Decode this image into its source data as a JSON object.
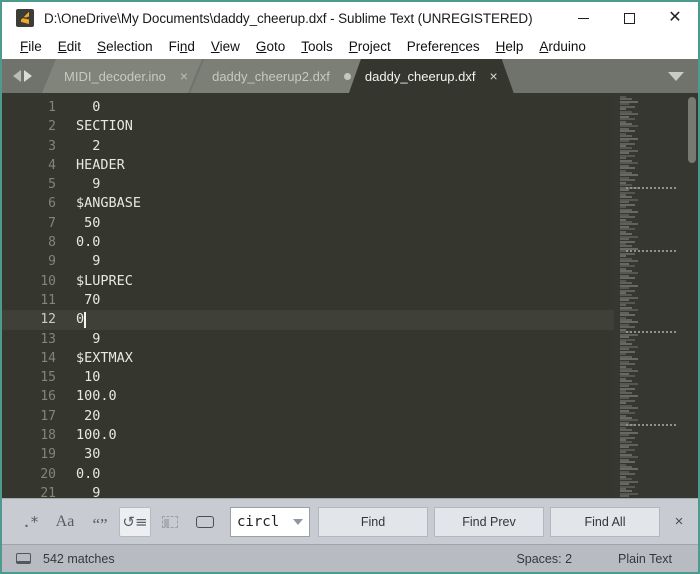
{
  "window": {
    "title": "D:\\OneDrive\\My Documents\\daddy_cheerup.dxf - Sublime Text (UNREGISTERED)",
    "app_icon": "sublime-text-icon",
    "accent_border": "#4d9a8f",
    "controls": {
      "minimize": "minimize-icon",
      "maximize": "maximize-icon",
      "close": "close-icon"
    }
  },
  "menubar": {
    "items": [
      {
        "label": "File",
        "accel": "F"
      },
      {
        "label": "Edit",
        "accel": "E"
      },
      {
        "label": "Selection",
        "accel": "S"
      },
      {
        "label": "Find",
        "accel": "n"
      },
      {
        "label": "View",
        "accel": "V"
      },
      {
        "label": "Goto",
        "accel": "G"
      },
      {
        "label": "Tools",
        "accel": "T"
      },
      {
        "label": "Project",
        "accel": "P"
      },
      {
        "label": "Preferences",
        "accel": "n"
      },
      {
        "label": "Help",
        "accel": "H"
      },
      {
        "label": "Arduino",
        "accel": "A"
      }
    ]
  },
  "tabbar": {
    "nav_prev": "chevron-left-icon",
    "nav_next": "chevron-right-icon",
    "menu_caret": "chevron-down-icon",
    "tabs": [
      {
        "label": "MIDI_decoder.ino",
        "active": false,
        "dirty": false,
        "close": "×"
      },
      {
        "label": "daddy_cheerup2.dxf",
        "active": false,
        "dirty": true,
        "close": "×"
      },
      {
        "label": "daddy_cheerup.dxf",
        "active": true,
        "dirty": false,
        "close": "×"
      }
    ]
  },
  "editor": {
    "cursor_line": 12,
    "lines": [
      {
        "num": "1",
        "text": "  0"
      },
      {
        "num": "2",
        "text": "SECTION"
      },
      {
        "num": "3",
        "text": "  2"
      },
      {
        "num": "4",
        "text": "HEADER"
      },
      {
        "num": "5",
        "text": "  9"
      },
      {
        "num": "6",
        "text": "$ANGBASE"
      },
      {
        "num": "7",
        "text": " 50"
      },
      {
        "num": "8",
        "text": "0.0"
      },
      {
        "num": "9",
        "text": "  9"
      },
      {
        "num": "10",
        "text": "$LUPREC"
      },
      {
        "num": "11",
        "text": " 70"
      },
      {
        "num": "12",
        "text": "0"
      },
      {
        "num": "13",
        "text": "  9"
      },
      {
        "num": "14",
        "text": "$EXTMAX"
      },
      {
        "num": "15",
        "text": " 10"
      },
      {
        "num": "16",
        "text": "100.0"
      },
      {
        "num": "17",
        "text": " 20"
      },
      {
        "num": "18",
        "text": "100.0"
      },
      {
        "num": "19",
        "text": " 30"
      },
      {
        "num": "20",
        "text": "0.0"
      },
      {
        "num": "21",
        "text": "  9"
      }
    ]
  },
  "findbar": {
    "options": [
      {
        "name": "regex-toggle",
        "glyph": ".*",
        "state": "off",
        "title": "Regular expression"
      },
      {
        "name": "case-sensitive-toggle",
        "glyph": "Aa",
        "state": "off",
        "title": "Case sensitive"
      },
      {
        "name": "whole-word-toggle",
        "glyph": "“”",
        "state": "off",
        "title": "Whole word"
      },
      {
        "name": "wrap-toggle",
        "glyph": "↺≡",
        "state": "on",
        "title": "Wrap"
      },
      {
        "name": "in-selection-toggle",
        "glyph": "selbox",
        "state": "disabled",
        "title": "In selection"
      },
      {
        "name": "highlight-results-toggle",
        "glyph": "hlbox",
        "state": "off",
        "title": "Highlight results"
      }
    ],
    "search_value": "circl",
    "search_placeholder": "Find",
    "dropdown_icon": "chevron-down-icon",
    "buttons": [
      {
        "label": "Find",
        "name": "find-button"
      },
      {
        "label": "Find Prev",
        "name": "find-prev-button"
      },
      {
        "label": "Find All",
        "name": "find-all-button"
      }
    ],
    "close_label": "×"
  },
  "statusbar": {
    "icon": "panel-icon",
    "matches": "542 matches",
    "indentation": "Spaces: 2",
    "syntax": "Plain Text"
  }
}
